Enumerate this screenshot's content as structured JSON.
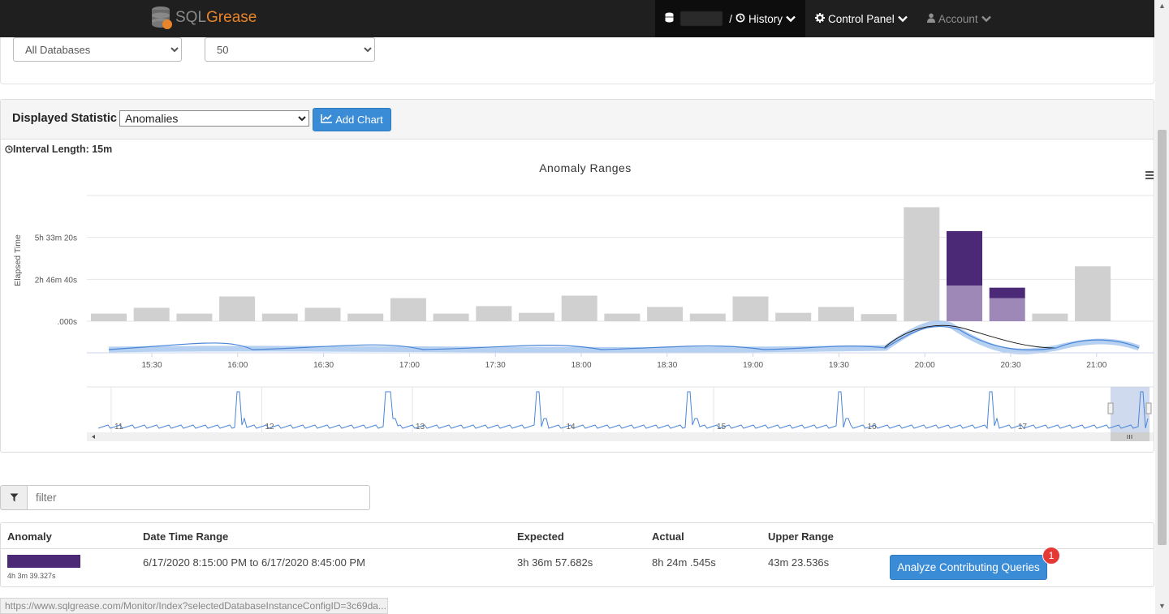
{
  "navbar": {
    "logo_sql": "SQL",
    "logo_grease": "Grease",
    "history_label": "History",
    "control_panel_label": "Control Panel",
    "account_label": "Account"
  },
  "filters": {
    "database_value": "All Databases",
    "count_value": "50"
  },
  "statistic": {
    "label": "Displayed Statistic",
    "selected": "Anomalies",
    "add_chart_label": "Add Chart",
    "interval_label": "Interval Length: 15m"
  },
  "chart_data": {
    "type": "bar",
    "title": "Anomaly Ranges",
    "ylabel": "Elapsed Time",
    "ytick_labels": [
      ".000s",
      "2h 46m 40s",
      "5h 33m 20s"
    ],
    "ytick_values_seconds": [
      0,
      10000,
      20000
    ],
    "ylim_seconds": [
      0,
      30000
    ],
    "categories": [
      "15:15",
      "15:30",
      "15:45",
      "16:00",
      "16:15",
      "16:30",
      "16:45",
      "17:00",
      "17:15",
      "17:30",
      "17:45",
      "18:00",
      "18:15",
      "18:30",
      "18:45",
      "19:00",
      "19:15",
      "19:30",
      "19:45",
      "20:00",
      "20:15",
      "20:30",
      "20:45",
      "21:00"
    ],
    "xtick_labels": [
      "15:30",
      "16:00",
      "16:30",
      "17:00",
      "17:30",
      "18:00",
      "18:30",
      "19:00",
      "19:30",
      "20:00",
      "20:30",
      "21:00"
    ],
    "series": [
      {
        "values": [
          1800,
          3200,
          1800,
          5900,
          1800,
          3200,
          1800,
          5500,
          1800,
          3600,
          2000,
          6100,
          1800,
          3400,
          1800,
          5900,
          2000,
          3400,
          1700,
          27200,
          8500,
          5500,
          1800,
          13100
        ]
      },
      {
        "values": [
          0,
          0,
          0,
          0,
          0,
          0,
          0,
          0,
          0,
          0,
          0,
          0,
          0,
          0,
          0,
          0,
          0,
          0,
          0,
          0,
          13000,
          2500,
          0,
          0
        ]
      }
    ],
    "navigator_labels": [
      "11",
      "12",
      "13",
      "14",
      "15",
      "16",
      "17"
    ],
    "colors": {
      "normal": "#d0d0d0",
      "anomaly": "#4b2977",
      "expected": "#9d88b8",
      "line": "#4a86d8"
    }
  },
  "filter": {
    "placeholder": "filter"
  },
  "table": {
    "headers": [
      "Anomaly",
      "Date Time Range",
      "Expected",
      "Actual",
      "Upper Range"
    ],
    "rows": [
      {
        "swatch_caption": "4h 3m 39.327s",
        "range": "6/17/2020 8:15:00 PM to 6/17/2020 8:45:00 PM",
        "expected": "3h 36m 57.682s",
        "actual": "8h 24m .545s",
        "upper": "43m 23.536s",
        "button_label": "Analyze Contributing Queries",
        "badge": "1"
      }
    ]
  },
  "status_url": "https://www.sqlgrease.com/Monitor/Index?selectedDatabaseInstanceConfigID=3c69da..."
}
